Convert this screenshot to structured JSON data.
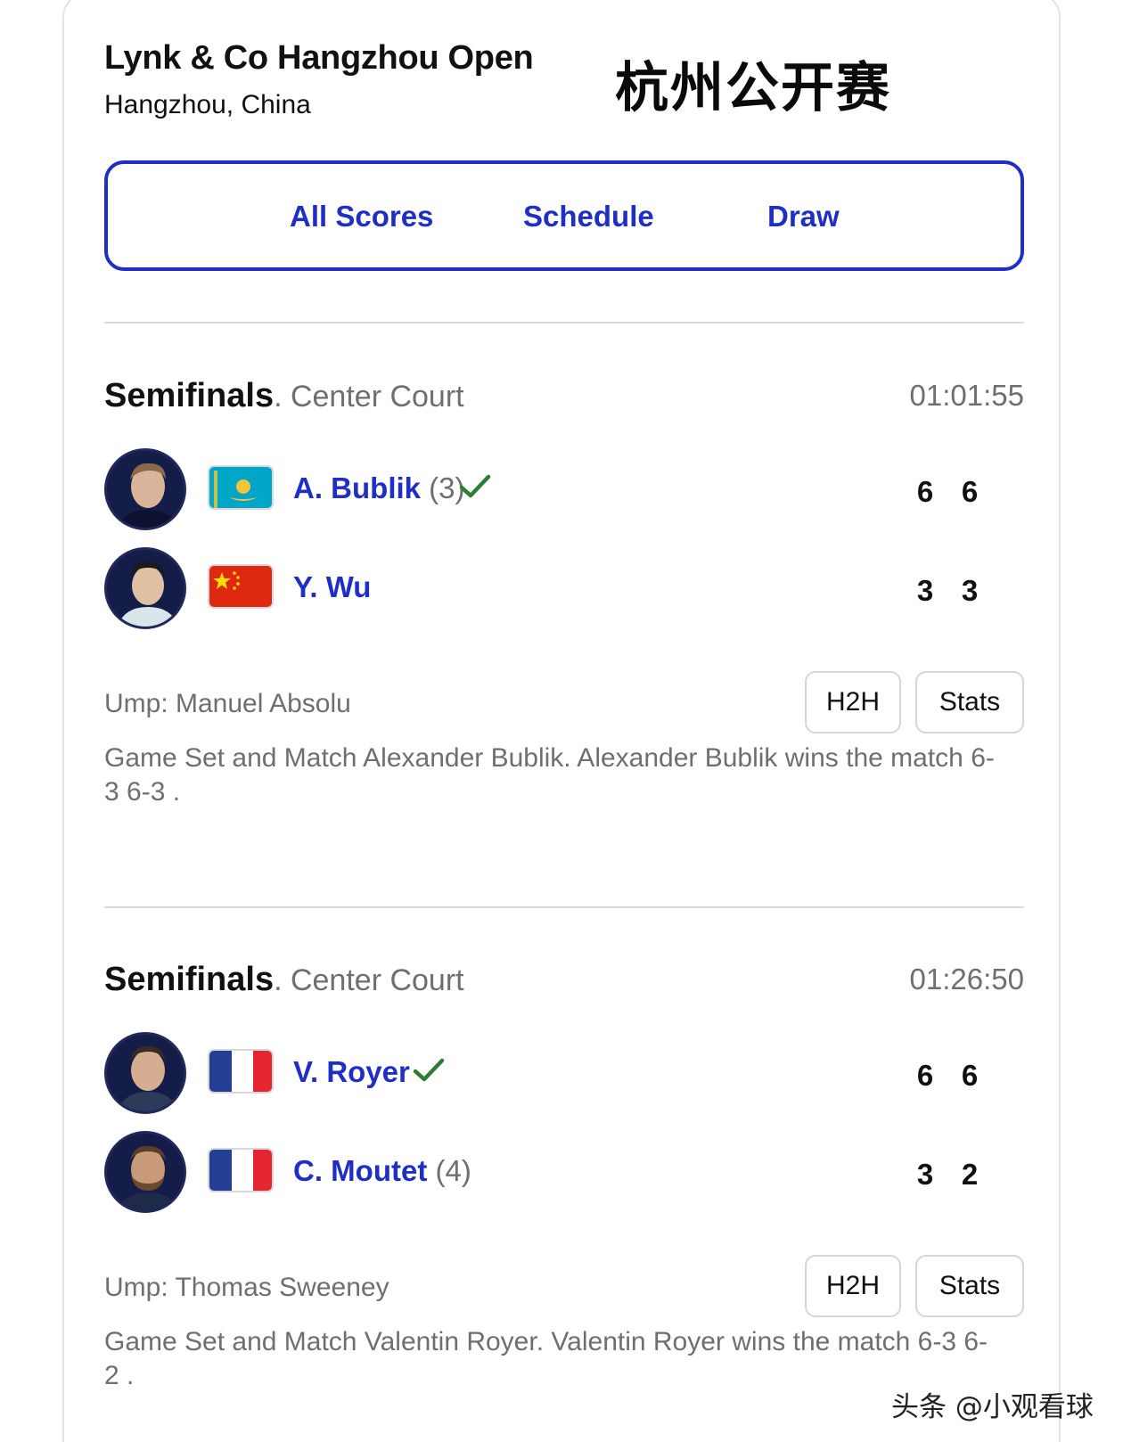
{
  "tournament": {
    "name": "Lynk & Co Hangzhou Open",
    "location": "Hangzhou, China",
    "cn_title": "杭州公开赛"
  },
  "nav": {
    "tabs": [
      {
        "label": "All Scores"
      },
      {
        "label": "Schedule"
      },
      {
        "label": "Draw"
      }
    ]
  },
  "matches": [
    {
      "round": "Semifinals",
      "court": ". Center Court",
      "duration": "01:01:55",
      "players": [
        {
          "name": "A. Bublik",
          "seed": " (3)",
          "flag": "Kazakhstan",
          "winner": true,
          "scores": [
            "6",
            "6"
          ]
        },
        {
          "name": "Y. Wu",
          "seed": "",
          "flag": "China",
          "winner": false,
          "scores": [
            "3",
            "3"
          ]
        }
      ],
      "umpire": "Ump: Manuel Absolu",
      "h2h_label": "H2H",
      "stats_label": "Stats",
      "summary": "Game Set and Match Alexander Bublik. Alexander Bublik wins the match 6-3 6-3 ."
    },
    {
      "round": "Semifinals",
      "court": ". Center Court",
      "duration": "01:26:50",
      "players": [
        {
          "name": "V. Royer",
          "seed": "",
          "flag": "France",
          "winner": true,
          "scores": [
            "6",
            "6"
          ]
        },
        {
          "name": "C. Moutet",
          "seed": " (4)",
          "flag": "France",
          "winner": false,
          "scores": [
            "3",
            "2"
          ]
        }
      ],
      "umpire": "Ump: Thomas Sweeney",
      "h2h_label": "H2H",
      "stats_label": "Stats",
      "summary": "Game Set and Match Valentin Royer. Valentin Royer wins the match 6-3 6-2 ."
    }
  ],
  "watermark": "头条 @小观看球",
  "colors": {
    "accent": "#1f2fc6",
    "winner_check": "#2e7d32",
    "muted_text": "#6e6e73"
  }
}
